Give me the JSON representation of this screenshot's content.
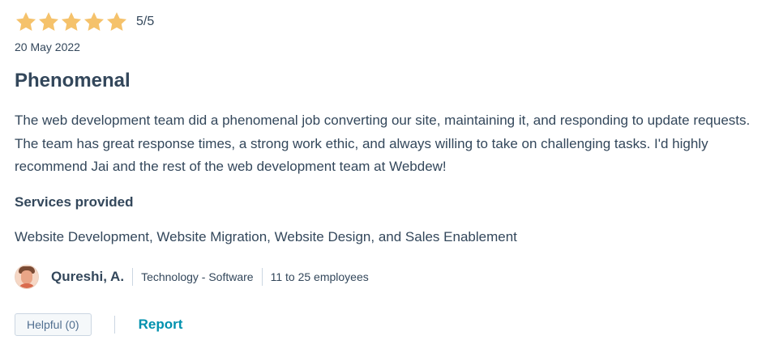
{
  "review": {
    "rating": {
      "value": 5,
      "max": 5,
      "score_text": "5/5",
      "star_color": "#f5c26b"
    },
    "date": "20 May 2022",
    "title": "Phenomenal",
    "body": "The web development team did a phenomenal job converting our site, maintaining it, and responding to update requests. The team has great response times, a strong work ethic, and always willing to take on challenging tasks. I'd highly recommend Jai and the rest of the web development team at Webdew!",
    "services": {
      "label": "Services provided",
      "value": "Website Development, Website Migration, Website Design, and Sales Enablement"
    },
    "reviewer": {
      "name": "Qureshi, A.",
      "industry": "Technology - Software",
      "company_size": "11 to 25 employees"
    },
    "actions": {
      "helpful_label": "Helpful (0)",
      "report_label": "Report",
      "report_color": "#0091ae"
    }
  }
}
